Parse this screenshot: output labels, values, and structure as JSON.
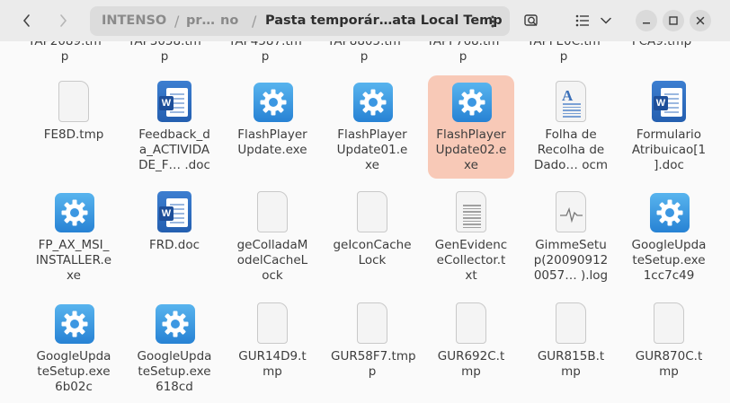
{
  "header": {
    "path": {
      "root": "INTENSO",
      "middle": "pr…",
      "middle2": "no",
      "current": "Pasta temporár…ata Local Temp"
    }
  },
  "icons": {
    "back": "chevron-left-icon",
    "forward": "chevron-right-icon",
    "menu": "kebab-menu-icon",
    "search": "search-icon",
    "list_view": "list-view-icon",
    "view_options": "chevron-down-icon",
    "minimize": "minimize-icon",
    "maximize": "maximize-icon",
    "close": "close-icon"
  },
  "colors": {
    "selection": "#f8c9b7",
    "exe_blue": "#2782d4",
    "word_blue": "#245fb0"
  },
  "partial_row": [
    {
      "line1": "TAP2089.tm",
      "line2": "p"
    },
    {
      "line1": "TAP3058.tm",
      "line2": "p"
    },
    {
      "line1": "TAP4587.tm",
      "line2": "p"
    },
    {
      "line1": "TAP8805.tm",
      "line2": "p"
    },
    {
      "line1": "TAPF768.tm",
      "line2": "p"
    },
    {
      "line1": "TAPFE0C.tm",
      "line2": "p"
    },
    {
      "line1": "FCA9.tmp",
      "line2": ""
    }
  ],
  "files": [
    {
      "lines": [
        "FE8D.tmp"
      ],
      "icon": "blank-file-icon"
    },
    {
      "lines": [
        "Feedback_d",
        "a_ACTIVIDA",
        "DE_F…  .doc"
      ],
      "icon": "word-document-icon"
    },
    {
      "lines": [
        "FlashPlayer",
        "Update.exe"
      ],
      "icon": "executable-gear-icon"
    },
    {
      "lines": [
        "FlashPlayer",
        "Update01.e",
        "xe"
      ],
      "icon": "executable-gear-icon"
    },
    {
      "lines": [
        "FlashPlayer",
        "Update02.e",
        "xe"
      ],
      "icon": "executable-gear-icon",
      "selected": true
    },
    {
      "lines": [
        "Folha de",
        "Recolha de",
        "Dado…  ocm"
      ],
      "icon": "text-document-icon"
    },
    {
      "lines": [
        "Formulario",
        "Atribuicao[1",
        "].doc"
      ],
      "icon": "word-document-icon"
    },
    {
      "lines": [
        "FP_AX_MSI_",
        "INSTALLER.e",
        "xe"
      ],
      "icon": "executable-gear-icon"
    },
    {
      "lines": [
        "FRD.doc"
      ],
      "icon": "word-document-icon"
    },
    {
      "lines": [
        "geColladaM",
        "odelCacheL",
        "ock"
      ],
      "icon": "blank-file-icon"
    },
    {
      "lines": [
        "geIconCache",
        "Lock"
      ],
      "icon": "blank-file-icon"
    },
    {
      "lines": [
        "GenEvidenc",
        "eCollector.t",
        "xt"
      ],
      "icon": "text-file-icon"
    },
    {
      "lines": [
        "GimmeSetu",
        "p(20090912",
        "0057…  ).log"
      ],
      "icon": "log-file-icon"
    },
    {
      "lines": [
        "GoogleUpda",
        "teSetup.exe",
        "1cc7c49"
      ],
      "icon": "executable-gear-icon"
    },
    {
      "lines": [
        "GoogleUpda",
        "teSetup.exe",
        "6b02c"
      ],
      "icon": "executable-gear-icon"
    },
    {
      "lines": [
        "GoogleUpda",
        "teSetup.exe",
        "618cd"
      ],
      "icon": "executable-gear-icon"
    },
    {
      "lines": [
        "GUR14D9.t",
        "mp"
      ],
      "icon": "blank-file-icon"
    },
    {
      "lines": [
        "GUR58F7.tmp",
        "p"
      ],
      "icon": "blank-file-icon"
    },
    {
      "lines": [
        "GUR692C.t",
        "mp"
      ],
      "icon": "blank-file-icon"
    },
    {
      "lines": [
        "GUR815B.t",
        "mp"
      ],
      "icon": "blank-file-icon"
    },
    {
      "lines": [
        "GUR870C.t",
        "mp"
      ],
      "icon": "blank-file-icon"
    }
  ]
}
